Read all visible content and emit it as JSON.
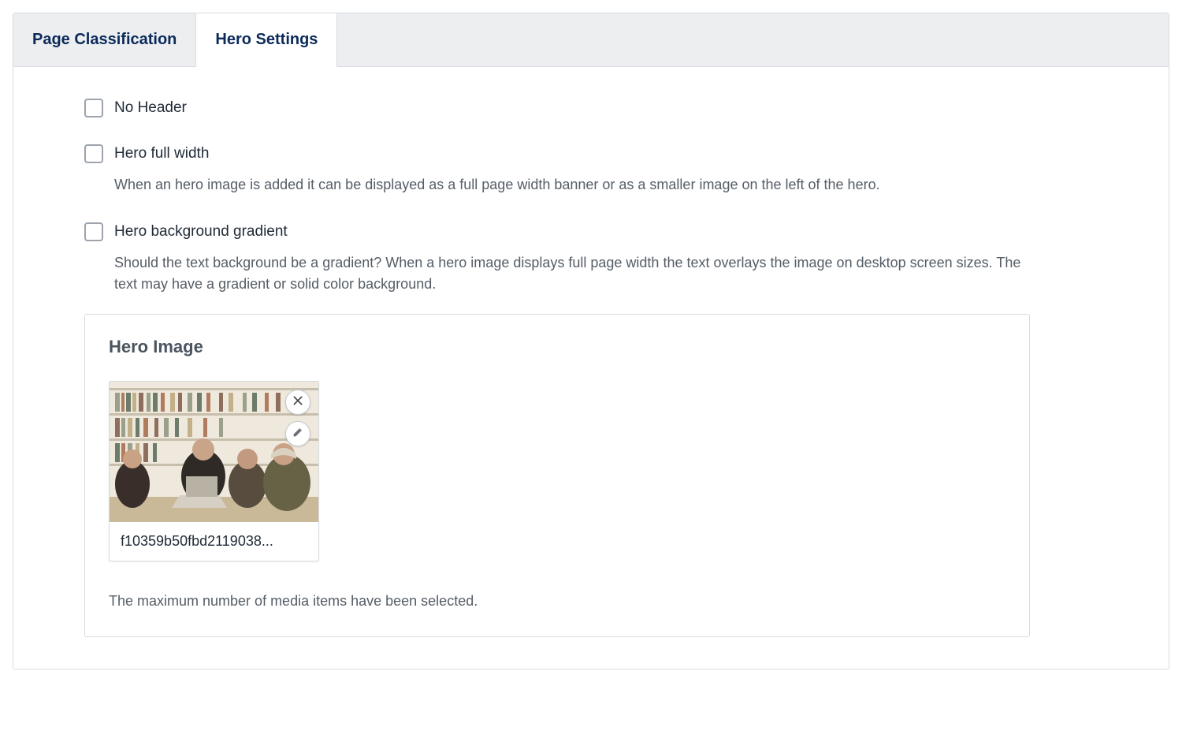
{
  "tabs": {
    "page_classification": "Page Classification",
    "hero_settings": "Hero Settings"
  },
  "settings": {
    "no_header": {
      "label": "No Header"
    },
    "hero_full_width": {
      "label": "Hero full width",
      "help": "When an hero image is added it can be displayed as a full page width banner or as a smaller image on the left of the hero."
    },
    "hero_bg_gradient": {
      "label": "Hero background gradient",
      "help": "Should the text background be a gradient? When a hero image displays full page width the text overlays the image on desktop screen sizes. The text may have a gradient or solid color background."
    }
  },
  "hero_image": {
    "title": "Hero Image",
    "item": {
      "filename": "f10359b50fbd2119038..."
    },
    "max_message": "The maximum number of media items have been selected."
  }
}
